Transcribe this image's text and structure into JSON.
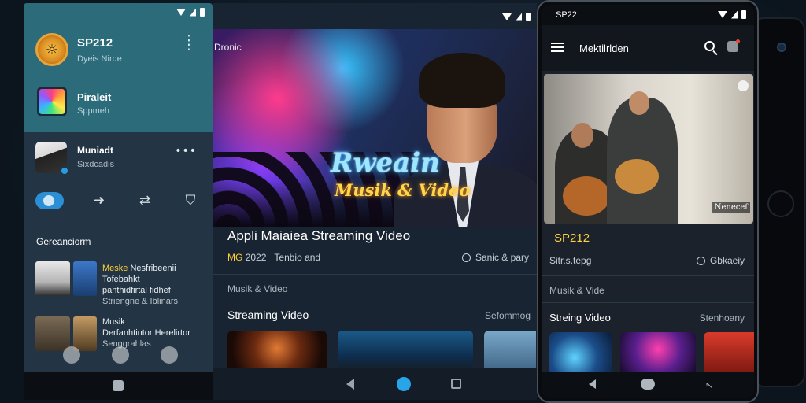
{
  "drawer": {
    "account": {
      "name": "SP212",
      "subtitle": "Dyeis Nirde"
    },
    "playlist": {
      "title": "Piraleit",
      "subtitle": "Sppmeh"
    },
    "now_playing": {
      "title": "Muniadt",
      "subtitle": "Sixdcadis"
    },
    "controls": [
      "toggle",
      "next-icon",
      "repeat-icon",
      "shield-icon"
    ],
    "section_title": "Gereanciorm",
    "rows": [
      {
        "line1_hl": "Meske",
        "line1": " Nesfribeenii Tofebahkt",
        "line2": "panthidfirtal fidhef",
        "line3": "Striengne & Iblinars"
      },
      {
        "line1_hl": "",
        "line1": "Musik",
        "line2": "Derfanhtintor Herelirtor",
        "line3": "Senggrahlas"
      }
    ]
  },
  "tablet": {
    "hero_label": "Dronic",
    "hero_text_1": "Rweain",
    "hero_text_2": "Musik & Video",
    "title": "Appli Maiaiea  Streaming Video",
    "meta_highlight": "MG",
    "meta_year": " 2022",
    "meta_rest": "Tenbio and",
    "share_label": "Sanic & pary",
    "category": "Musik & Video",
    "section_title": "Streaming Video",
    "section_more": "Sefommog"
  },
  "phone": {
    "status_time": "SP22",
    "app_title": "Mektilrlden",
    "hero_tag": "Nenecef",
    "artist": "SP212",
    "meta": "Sitr.s.tepg",
    "share_label": "Gbkaeiy",
    "category": "Musik & Vide",
    "section_title": "Streing Video",
    "section_more": "Stenhoany"
  },
  "colors": {
    "accent": "#ffd23a",
    "primary": "#2b8fd6",
    "drawer_header": "#2b6b7a"
  }
}
